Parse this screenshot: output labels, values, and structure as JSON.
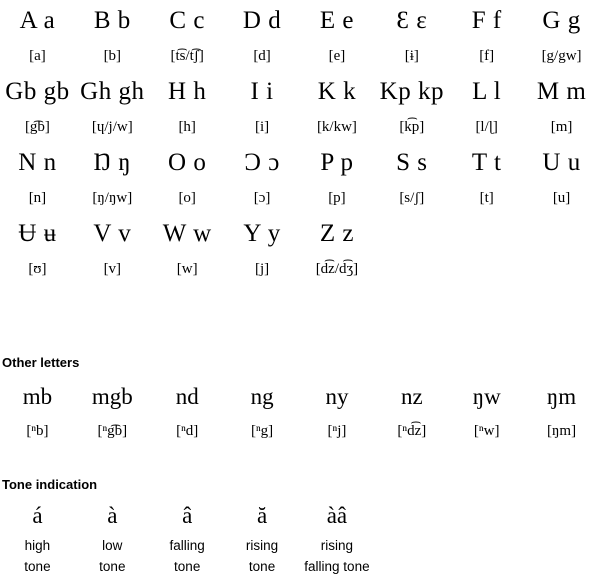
{
  "page": {
    "background_color": "#ffffff",
    "text_color": "#000000"
  },
  "alphabet": {
    "rows": [
      [
        {
          "letter": "A a",
          "ipa": "[a]"
        },
        {
          "letter": "B b",
          "ipa": "[b]"
        },
        {
          "letter": "C c",
          "ipa": "[t͡s/t͡ʃ]"
        },
        {
          "letter": "D d",
          "ipa": "[d]"
        },
        {
          "letter": "E e",
          "ipa": "[e]"
        },
        {
          "letter": "Ɛ ɛ",
          "ipa": "[ɨ]"
        },
        {
          "letter": "F f",
          "ipa": "[f]"
        },
        {
          "letter": "G g",
          "ipa": "[g/gw]"
        }
      ],
      [
        {
          "letter": "Gb gb",
          "ipa": "[g͡b]"
        },
        {
          "letter": "Gh gh",
          "ipa": "[ɥ/j/w]"
        },
        {
          "letter": "H h",
          "ipa": "[h]"
        },
        {
          "letter": "I i",
          "ipa": "[i]"
        },
        {
          "letter": "K k",
          "ipa": "[k/kw]"
        },
        {
          "letter": "Kp kp",
          "ipa": "[k͡p]"
        },
        {
          "letter": "L l",
          "ipa": "[l/ɭ]"
        },
        {
          "letter": "M m",
          "ipa": "[m]"
        }
      ],
      [
        {
          "letter": "N n",
          "ipa": "[n]"
        },
        {
          "letter": "Ŋ ŋ",
          "ipa": "[ŋ/ŋw]"
        },
        {
          "letter": "O o",
          "ipa": "[o]"
        },
        {
          "letter": "Ɔ ɔ",
          "ipa": "[ɔ]"
        },
        {
          "letter": "P p",
          "ipa": "[p]"
        },
        {
          "letter": "S s",
          "ipa": "[s/ʃ]"
        },
        {
          "letter": "T t",
          "ipa": "[t]"
        },
        {
          "letter": "U u",
          "ipa": "[u]"
        }
      ],
      [
        {
          "letter": "Ʉ ʉ",
          "ipa": "[ʊ]"
        },
        {
          "letter": "V v",
          "ipa": "[v]"
        },
        {
          "letter": "W w",
          "ipa": "[w]"
        },
        {
          "letter": "Y y",
          "ipa": "[j]"
        },
        {
          "letter": "Z z",
          "ipa": "[d͡z/d͡ʒ]"
        },
        {
          "letter": "",
          "ipa": ""
        },
        {
          "letter": "",
          "ipa": ""
        },
        {
          "letter": "",
          "ipa": ""
        }
      ]
    ]
  },
  "other_letters": {
    "heading": "Other letters",
    "items": [
      {
        "letter": "mb",
        "ipa": "[ⁿb]"
      },
      {
        "letter": "mgb",
        "ipa": "[ⁿg͡b]"
      },
      {
        "letter": "nd",
        "ipa": "[ⁿd]"
      },
      {
        "letter": "ng",
        "ipa": "[ⁿg]"
      },
      {
        "letter": "ny",
        "ipa": "[ⁿj]"
      },
      {
        "letter": "nz",
        "ipa": "[ⁿd͡z]"
      },
      {
        "letter": "ŋw",
        "ipa": "[ⁿw]"
      },
      {
        "letter": "ŋm",
        "ipa": "[ŋm]"
      }
    ]
  },
  "tone_indication": {
    "heading": "Tone indication",
    "items": [
      {
        "mark": "á",
        "line1": "high",
        "line2": "tone"
      },
      {
        "mark": "à",
        "line1": "low",
        "line2": "tone"
      },
      {
        "mark": "â",
        "line1": "falling",
        "line2": "tone"
      },
      {
        "mark": "ă",
        "line1": "rising",
        "line2": "tone"
      },
      {
        "mark": "àâ",
        "line1": "rising",
        "line2": "falling tone"
      }
    ]
  }
}
